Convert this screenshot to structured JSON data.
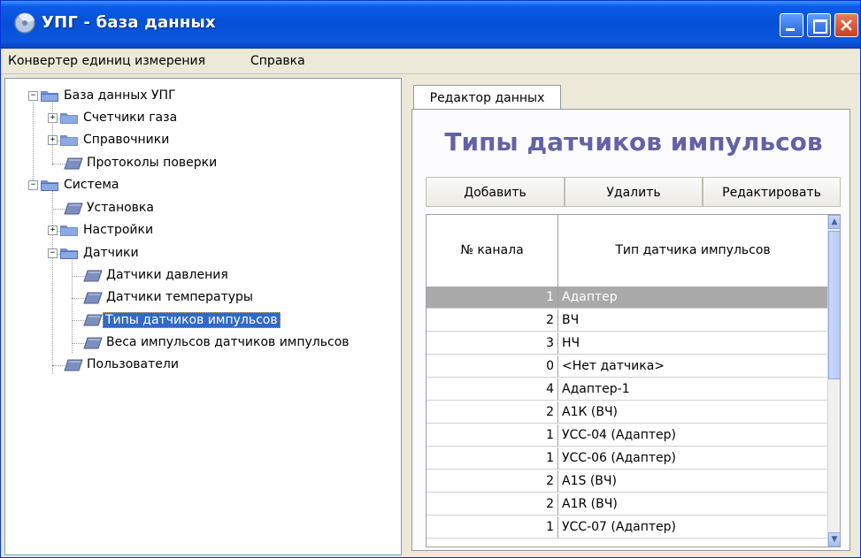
{
  "window": {
    "title": "УПГ - база данных"
  },
  "menu": {
    "items": [
      "Конвертер единиц измерения",
      "Справка"
    ]
  },
  "tree": {
    "items": [
      {
        "label": "База данных УПГ"
      },
      {
        "label": "Счетчики газа"
      },
      {
        "label": "Справочники"
      },
      {
        "label": "Протоколы поверки"
      },
      {
        "label": "Система"
      },
      {
        "label": "Установка"
      },
      {
        "label": "Настройки"
      },
      {
        "label": "Датчики"
      },
      {
        "label": "Датчики давления"
      },
      {
        "label": "Датчики температуры"
      },
      {
        "label": "Типы датчиков импульсов",
        "selected": true
      },
      {
        "label": "Веса импульсов датчиков импульсов"
      },
      {
        "label": "Пользователи"
      }
    ]
  },
  "editor": {
    "tab_label": "Редактор данных",
    "heading": "Типы датчиков импульсов",
    "buttons": {
      "add": "Добавить",
      "delete": "Удалить",
      "edit": "Редактировать"
    },
    "columns": [
      "№ канала",
      "Тип датчика импульсов"
    ],
    "rows": [
      {
        "channel": "1",
        "type": "Адаптер",
        "selected": true
      },
      {
        "channel": "2",
        "type": "ВЧ"
      },
      {
        "channel": "3",
        "type": "НЧ"
      },
      {
        "channel": "0",
        "type": "<Нет датчика>"
      },
      {
        "channel": "4",
        "type": "Адаптер-1"
      },
      {
        "channel": "2",
        "type": "А1К (ВЧ)"
      },
      {
        "channel": "1",
        "type": "УСС-04 (Адаптер)"
      },
      {
        "channel": "1",
        "type": "УСС-06 (Адаптер)"
      },
      {
        "channel": "2",
        "type": "А1S (ВЧ)"
      },
      {
        "channel": "2",
        "type": "А1R (ВЧ)"
      },
      {
        "channel": "1",
        "type": "УСС-07 (Адаптер)"
      }
    ]
  },
  "colors": {
    "titlebar": "#0551d6",
    "heading": "#6262a8",
    "selection": "#316ac5",
    "grid_selection": "#a9a9a9"
  }
}
